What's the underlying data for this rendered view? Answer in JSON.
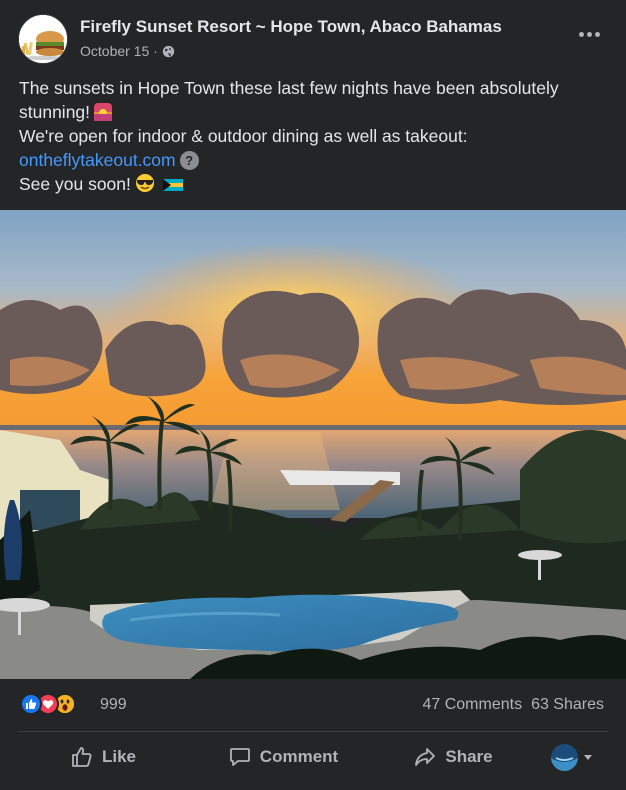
{
  "post": {
    "page_name": "Firefly Sunset Resort ~ Hope Town, Abaco Bahamas",
    "date": "October 15",
    "dot": "·",
    "text_line1a": "The sunsets in Hope Town these last few nights have been absolutely",
    "text_line1b": "stunning!",
    "text_line2": "We're open for indoor & outdoor dining as well as takeout:",
    "link": "ontheflytakeout.com",
    "help_glyph": "?",
    "text_line4": "See you soon!",
    "icons": {
      "avatar": "burger-logo-avatar",
      "privacy": "globe-icon",
      "more": "more-options-icon",
      "sunset_emoji": "sunset-emoji",
      "sunglasses_emoji": "sunglasses-emoji",
      "flag_emoji": "bahamas-flag-emoji"
    }
  },
  "photo": {
    "description_icon": "sunset-pool-photo"
  },
  "stats": {
    "reaction_count": "999",
    "comments": "47 Comments",
    "shares": "63 Shares",
    "reactions": [
      "like-reaction-icon",
      "love-reaction-icon",
      "wow-reaction-icon"
    ]
  },
  "actions": {
    "like": "Like",
    "comment": "Comment",
    "share": "Share"
  },
  "colors": {
    "card_bg": "#242526",
    "text": "#e4e6eb",
    "secondary_text": "#b0b3b8",
    "link": "#4599ff",
    "like_blue": "#1877f2",
    "love_red": "#f33e58",
    "wow_yellow": "#f7b125"
  }
}
